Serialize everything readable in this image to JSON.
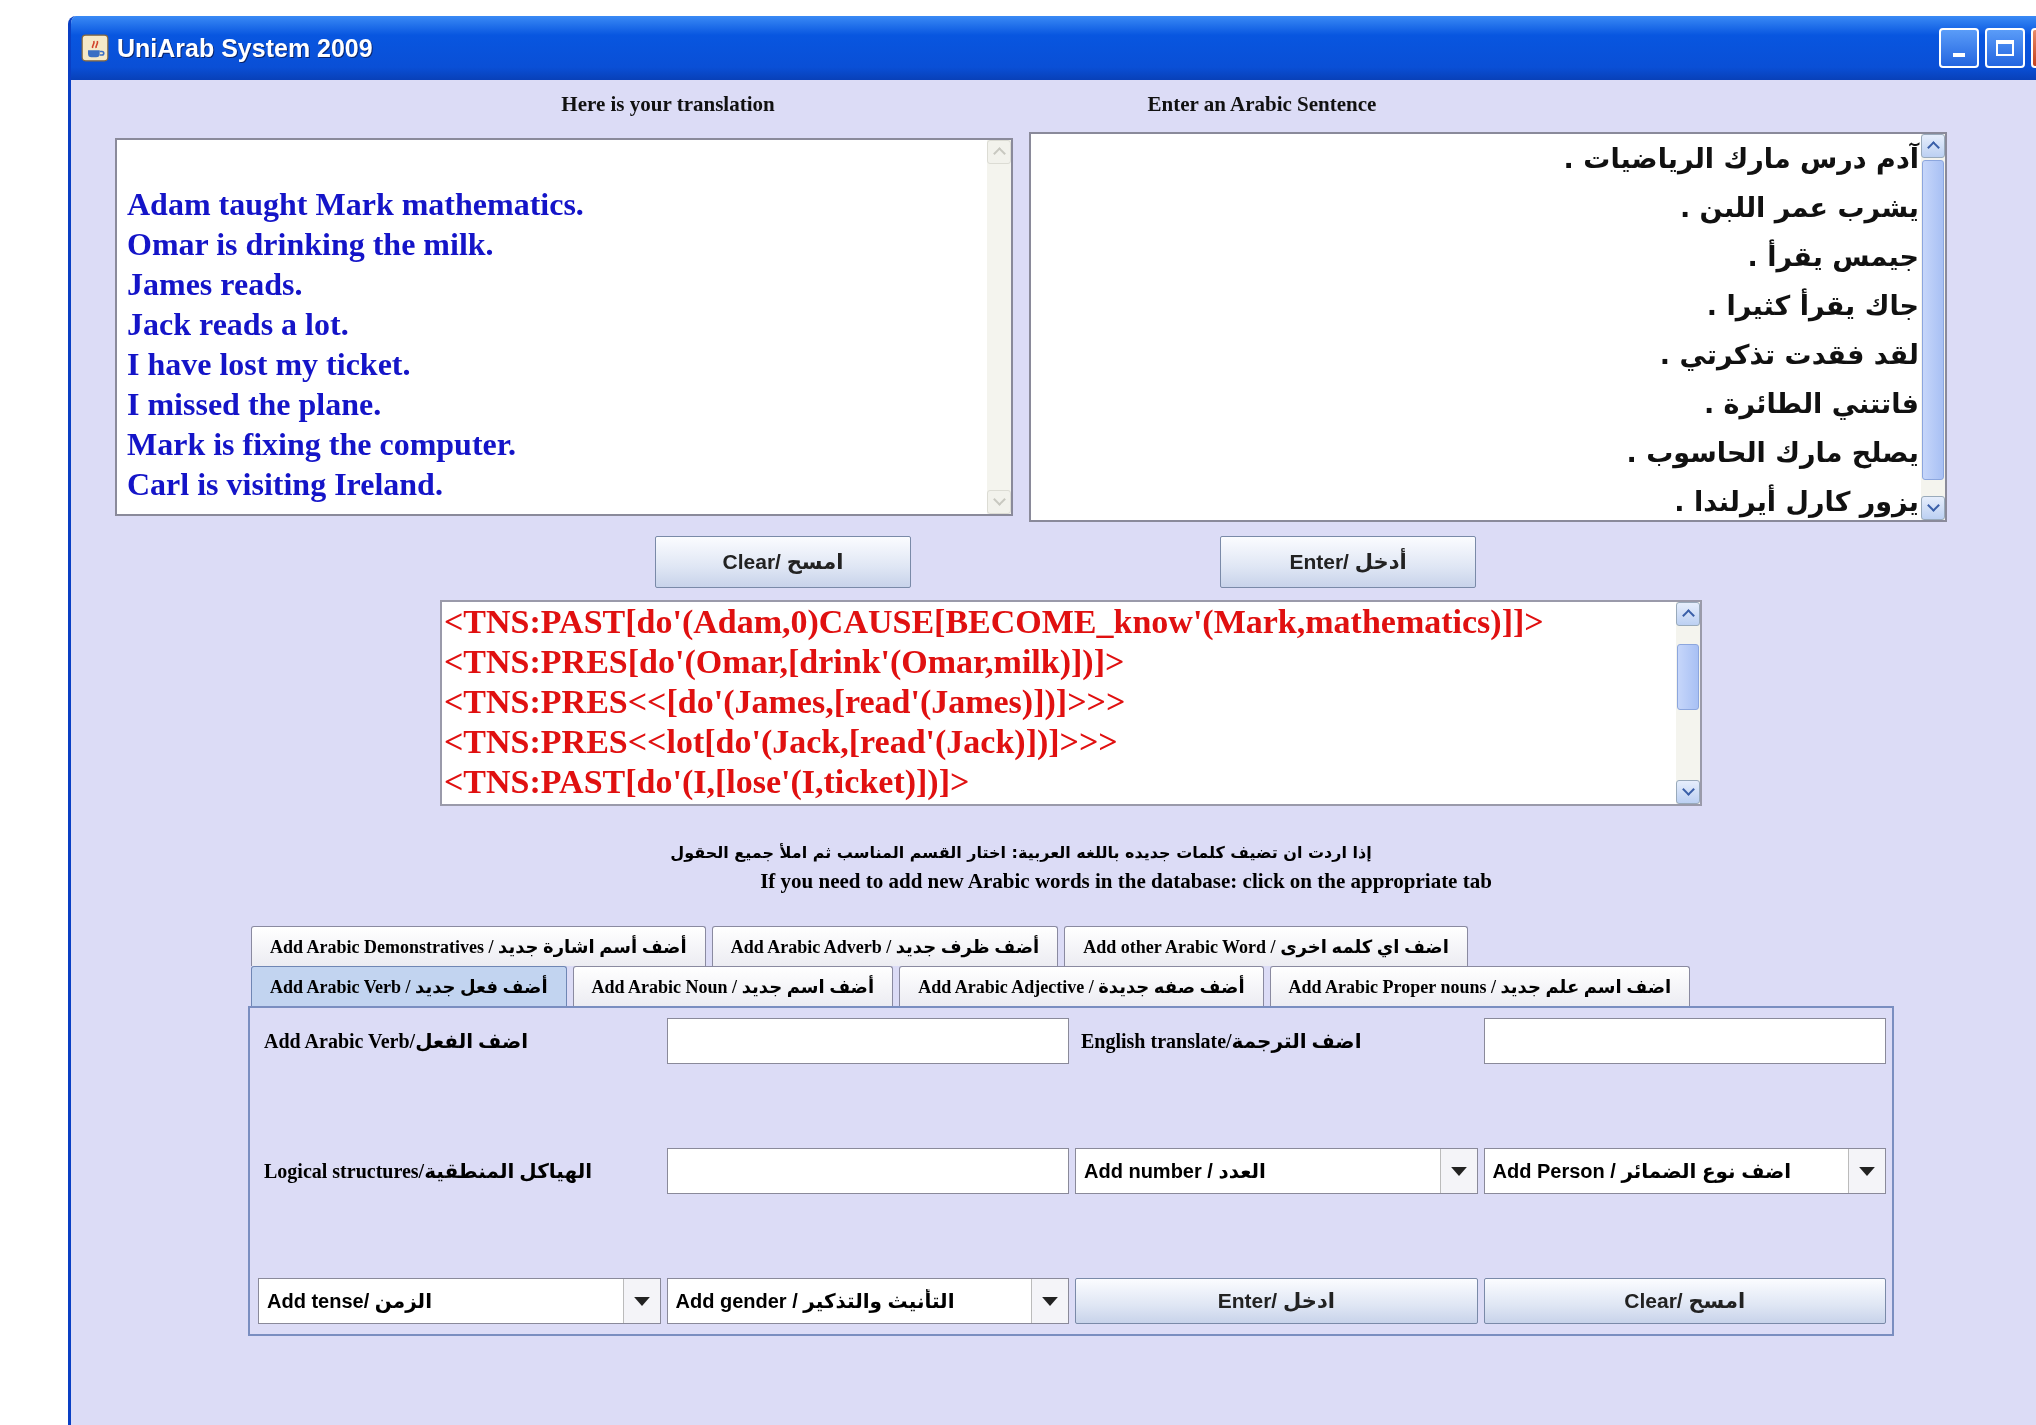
{
  "window": {
    "title": "UniArab System 2009"
  },
  "translation": {
    "label": "Here is your translation",
    "lines": [
      "Adam taught Mark mathematics.",
      "Omar is drinking the milk.",
      "James reads.",
      "Jack reads a lot.",
      "I have lost my ticket.",
      "I missed the plane.",
      "Mark is fixing the computer.",
      "Carl is visiting Ireland."
    ]
  },
  "arabic_input": {
    "label": "Enter an Arabic Sentence",
    "lines": [
      "آدم درس مارك الرياضيات .",
      "يشرب عمر اللبن .",
      "جيمس يقرأ .",
      "جاك يقرأ كثيرا .",
      "لقد فقدت تذكرتي .",
      "فاتتني الطائرة .",
      "يصلح مارك الحاسوب .",
      "يزور كارل أيرلندا ."
    ]
  },
  "buttons": [
    {
      "label": "Enter/ أدخل"
    },
    {
      "label": "Clear/ امسح"
    }
  ],
  "logical_output": {
    "lines": [
      "<TNS:PAST[do'(Adam,0)CAUSE[BECOME_know'(Mark,mathematics)]]>",
      "<TNS:PRES[do'(Omar,[drink'(Omar,milk)])]>",
      "<TNS:PRES<<[do'(James,[read'(James)])]>>>",
      "<TNS:PRES<<lot[do'(Jack,[read'(Jack)])]>>>",
      "<TNS:PAST[do'(I,[lose'(I,ticket)])]>"
    ]
  },
  "instructions": {
    "arabic": "إذا اردت ان تضيف كلمات جديده باللغه العربية: اختار القسم المناسب ثم املأ جميع الحقول",
    "english": "If you need to add new Arabic words in the database: click on the appropriate tab"
  },
  "tab_rows": [
    [
      {
        "label": "Add other Arabic Word / اضف اي كلمه اخرى",
        "selected": false
      },
      {
        "label": "Add Arabic Adverb / أضف ظرف جديد",
        "selected": false
      },
      {
        "label": "Add Arabic Demonstratives / أضف أسم اشارة جديد",
        "selected": false
      }
    ],
    [
      {
        "label": "Add Arabic Proper nouns / اضف اسم علم جديد",
        "selected": false
      },
      {
        "label": "Add Arabic Adjective / أضف صفه جديدة",
        "selected": false
      },
      {
        "label": "Add Arabic Noun / أضف اسم جديد",
        "selected": false
      },
      {
        "label": "Add Arabic Verb / أضف فعل جديد",
        "selected": true
      }
    ]
  ],
  "form": [
    {
      "kind": "input"
    },
    {
      "kind": "label",
      "text": "English translate/اضف الترجمة"
    },
    {
      "kind": "input"
    },
    {
      "kind": "label",
      "text": "Add Arabic Verb/اضف الفعل"
    },
    {
      "kind": "combo",
      "text": "Add Person / اضف نوع الضمائر"
    },
    {
      "kind": "combo",
      "text": "Add number / العدد"
    },
    {
      "kind": "input"
    },
    {
      "kind": "label",
      "text": "Logical structures/الهياكل المنطقية"
    },
    {
      "kind": "button",
      "text": "Clear/ امسح"
    },
    {
      "kind": "button",
      "text": "Enter/ ادخل"
    },
    {
      "kind": "combo",
      "text": "Add gender / التأنيث والتذكير"
    },
    {
      "kind": "combo",
      "text": "Add tense/ الزمن"
    }
  ]
}
